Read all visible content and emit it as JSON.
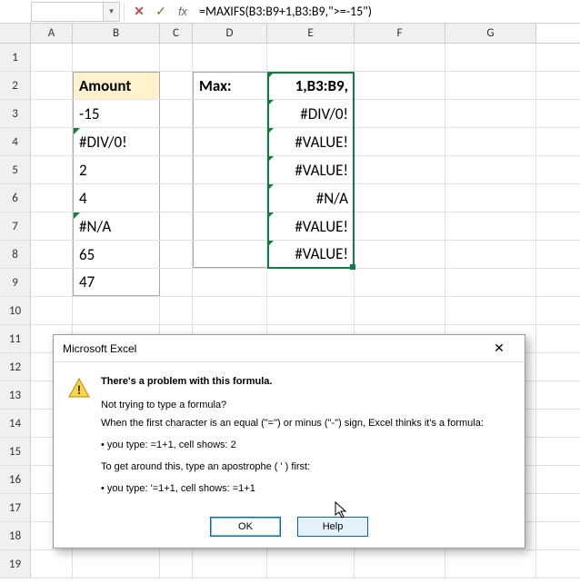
{
  "formula_bar": {
    "namebox": "",
    "cancel_glyph": "✕",
    "accept_glyph": "✓",
    "fx_glyph": "fx",
    "formula": "=MAXIFS(B3:B9+1,B3:B9,\">=-15\")"
  },
  "columns": [
    "A",
    "B",
    "C",
    "D",
    "E",
    "F",
    "G"
  ],
  "rows": [
    "1",
    "2",
    "3",
    "4",
    "5",
    "6",
    "7",
    "8",
    "9",
    "10",
    "11",
    "12",
    "13",
    "14",
    "15",
    "16",
    "17",
    "18",
    "19"
  ],
  "cells": {
    "B2": "Amount",
    "B3": "-15",
    "B4": "#DIV/0!",
    "B5": "2",
    "B6": "4",
    "B7": "#N/A",
    "B8": "65",
    "B9": "47",
    "D2": "Max:",
    "E2": "1,B3:B9,",
    "E3": "#DIV/0!",
    "E4": "#VALUE!",
    "E5": "#VALUE!",
    "E6": "#N/A",
    "E7": "#VALUE!",
    "E8": "#VALUE!"
  },
  "dialog": {
    "title": "Microsoft Excel",
    "p1": "There's a problem with this formula.",
    "p2a": "Not trying to type a formula?",
    "p2b": "When the first character is an equal (\"=\") or minus (\"-\") sign, Excel thinks it's a formula:",
    "p3": "• you type:   =1+1, cell shows:   2",
    "p4": "To get around this, type an apostrophe ( ' ) first:",
    "p5": "• you type:   '=1+1, cell shows:   =1+1",
    "ok": "OK",
    "help": "Help"
  }
}
